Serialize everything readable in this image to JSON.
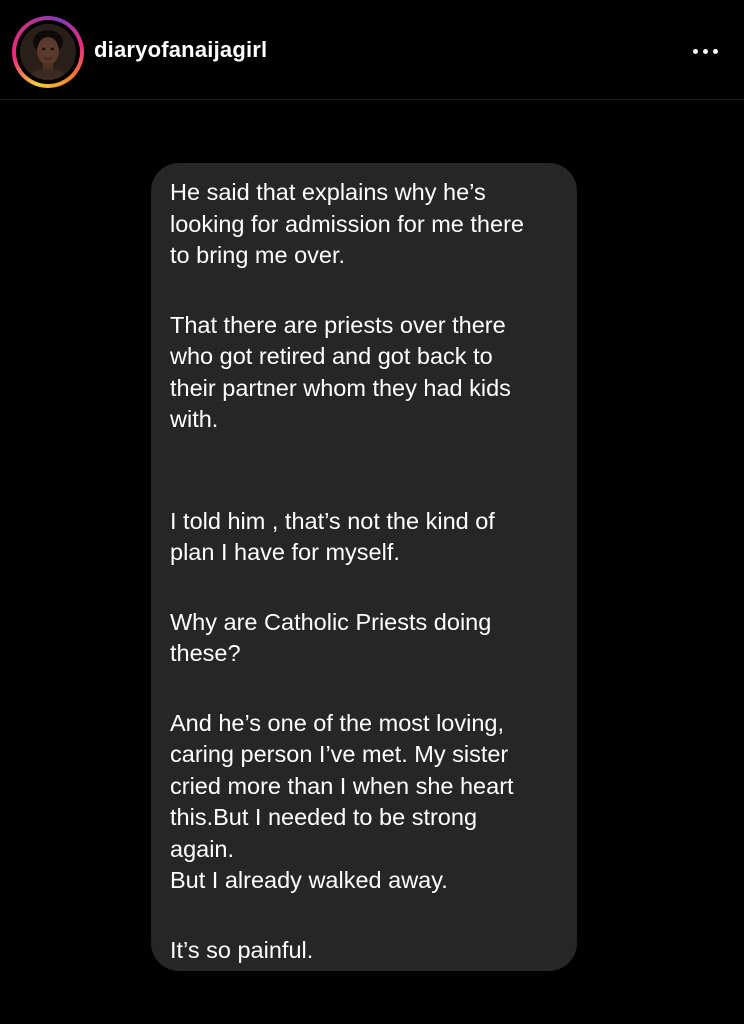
{
  "header": {
    "username": "diaryofanaijagirl",
    "avatar_icon": "profile-photo",
    "more_icon": "more-options-icon",
    "story_ring_colors": [
      "#f9ce34",
      "#ee2a7b",
      "#833ab4"
    ]
  },
  "message": {
    "bubble_color": "#262626",
    "paragraphs": [
      "He said that explains why he’s\nlooking for admission for me there\nto bring me over.",
      "That there are priests over there\nwho got retired and got back to\ntheir partner whom they had kids\nwith.",
      "I told him , that’s not the kind of\nplan I have for myself.",
      "Why are Catholic Priests doing\nthese?",
      "And he’s one of the most loving,\ncaring person I’ve met.  My sister\ncried more than I when she heart\nthis.But I needed to be strong\nagain.\nBut I already walked away.",
      "It’s so painful."
    ]
  }
}
